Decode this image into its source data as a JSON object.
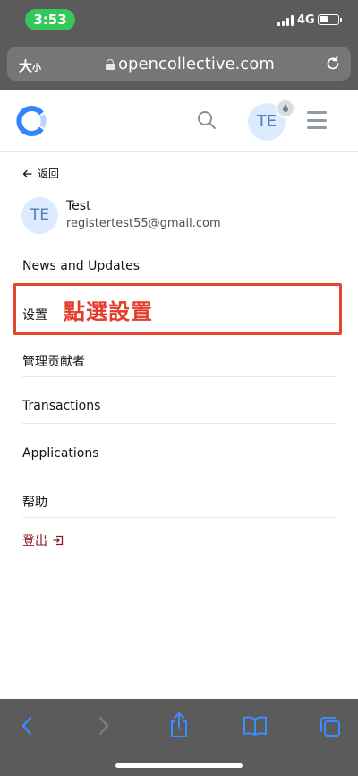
{
  "status_bar": {
    "time": "3:53",
    "network": "4G"
  },
  "browser": {
    "text_size_label": "大",
    "text_size_small": "小",
    "url": "opencollective.com"
  },
  "header": {
    "avatar_initials": "TE"
  },
  "menu": {
    "back_label": "返回",
    "user": {
      "initials": "TE",
      "name": "Test",
      "email": "registertest55@gmail.com"
    },
    "items": [
      {
        "label": "News and Updates"
      },
      {
        "label": "设置"
      },
      {
        "label": "管理贡献者"
      },
      {
        "label": "Transactions"
      },
      {
        "label": "Applications"
      },
      {
        "label": "帮助"
      }
    ],
    "logout_label": "登出"
  },
  "annotation": {
    "text": "點選設置",
    "color": "#e33b2c"
  },
  "colors": {
    "chrome": "#5b5b5b",
    "accent": "#3385ff",
    "avatar_bg": "#dcebfd",
    "logout": "#8a1b2a"
  }
}
